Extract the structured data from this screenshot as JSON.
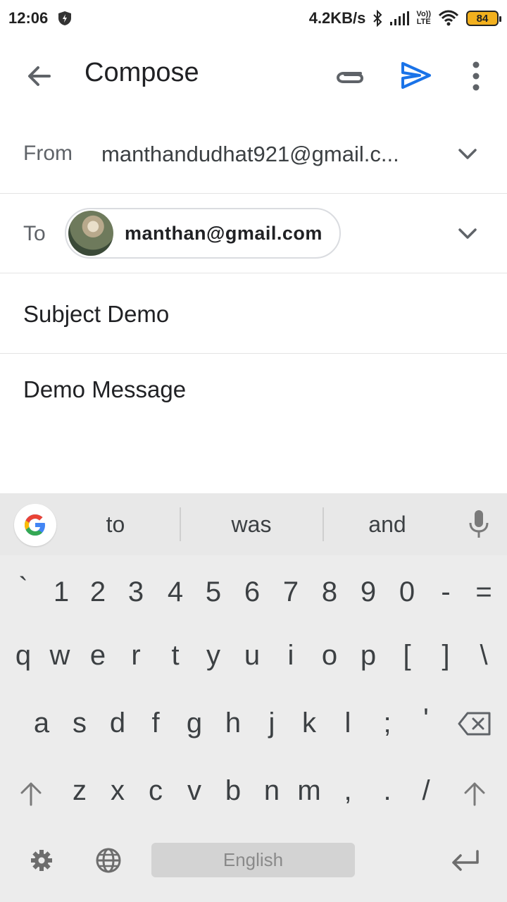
{
  "status_bar": {
    "time": "12:06",
    "net_speed": "4.2KB/s",
    "volte_top": "Vo))",
    "volte_bottom": "LTE",
    "battery": "84"
  },
  "app_bar": {
    "title": "Compose",
    "icons": [
      "back-arrow-icon",
      "paperclip-icon",
      "send-icon",
      "more-vert-icon"
    ],
    "send_color": "#1a73e8"
  },
  "compose": {
    "from_label": "From",
    "from_value": "manthandudhat921@gmail.c...",
    "to_label": "To",
    "to_chip": "manthan@gmail.com",
    "subject": "Subject Demo",
    "body": "Demo Message"
  },
  "keyboard": {
    "suggestions": [
      "to",
      "was",
      "and"
    ],
    "row_numbers": [
      "`",
      "1",
      "2",
      "3",
      "4",
      "5",
      "6",
      "7",
      "8",
      "9",
      "0",
      "-",
      "="
    ],
    "row_top": [
      "q",
      "w",
      "e",
      "r",
      "t",
      "y",
      "u",
      "i",
      "o",
      "p",
      "[",
      "]",
      "\\"
    ],
    "row_middle": [
      "a",
      "s",
      "d",
      "f",
      "g",
      "h",
      "j",
      "k",
      "l",
      ";",
      "'"
    ],
    "row_bottom": [
      "z",
      "x",
      "c",
      "v",
      "b",
      "n",
      "m",
      ",",
      ".",
      "/"
    ],
    "space_label": "English"
  }
}
